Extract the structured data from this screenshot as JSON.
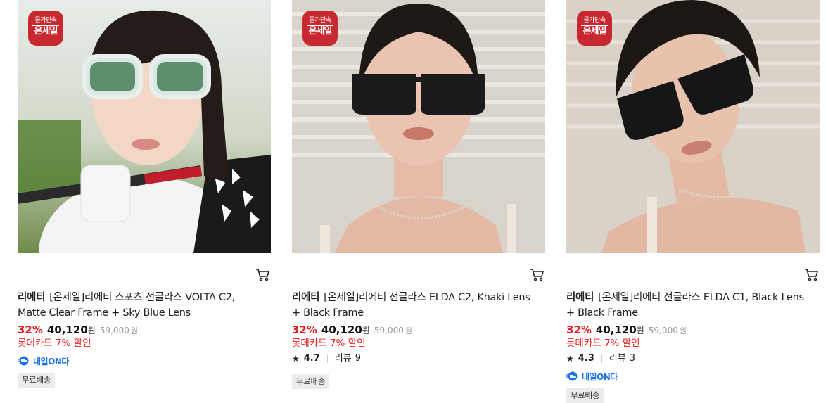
{
  "colors": {
    "accent": "#e02020",
    "badge": "#c8282f",
    "delivery": "#1a73e8"
  },
  "products": [
    {
      "badge_top": "물가단속",
      "badge_main": "온세일",
      "brand": "리에티",
      "name": "[온세일]리에티 스포츠 선글라스 VOLTA C2, Matte Clear Frame + Sky Blue Lens",
      "discount_rate": "32%",
      "price": "40,120",
      "price_unit": "원",
      "original_price": "59,000",
      "card_discount": "롯데카드 7% 할인",
      "delivery_label": "내일ON다",
      "shipping": "무료배송",
      "icons": {
        "cart": "cart-icon",
        "delivery": "truck-icon"
      }
    },
    {
      "badge_top": "물가단속",
      "badge_main": "온세일",
      "brand": "리에티",
      "name": "[온세일]리에티 선글라스 ELDA C2, Khaki Lens + Black Frame",
      "discount_rate": "32%",
      "price": "40,120",
      "price_unit": "원",
      "original_price": "59,000",
      "card_discount": "롯데카드 7% 할인",
      "rating": "4.7",
      "review_label": "리뷰",
      "review_count": "9",
      "shipping": "무료배송",
      "icons": {
        "cart": "cart-icon",
        "star": "star-icon"
      }
    },
    {
      "badge_top": "물가단속",
      "badge_main": "온세일",
      "brand": "리에티",
      "name": "[온세일]리에티 선글라스 ELDA C1, Black Lens + Black Frame",
      "discount_rate": "32%",
      "price": "40,120",
      "price_unit": "원",
      "original_price": "59,000",
      "card_discount": "롯데카드 7% 할인",
      "rating": "4.3",
      "review_label": "리뷰",
      "review_count": "3",
      "delivery_label": "내일ON다",
      "shipping": "무료배송",
      "icons": {
        "cart": "cart-icon",
        "star": "star-icon",
        "delivery": "truck-icon"
      }
    }
  ]
}
